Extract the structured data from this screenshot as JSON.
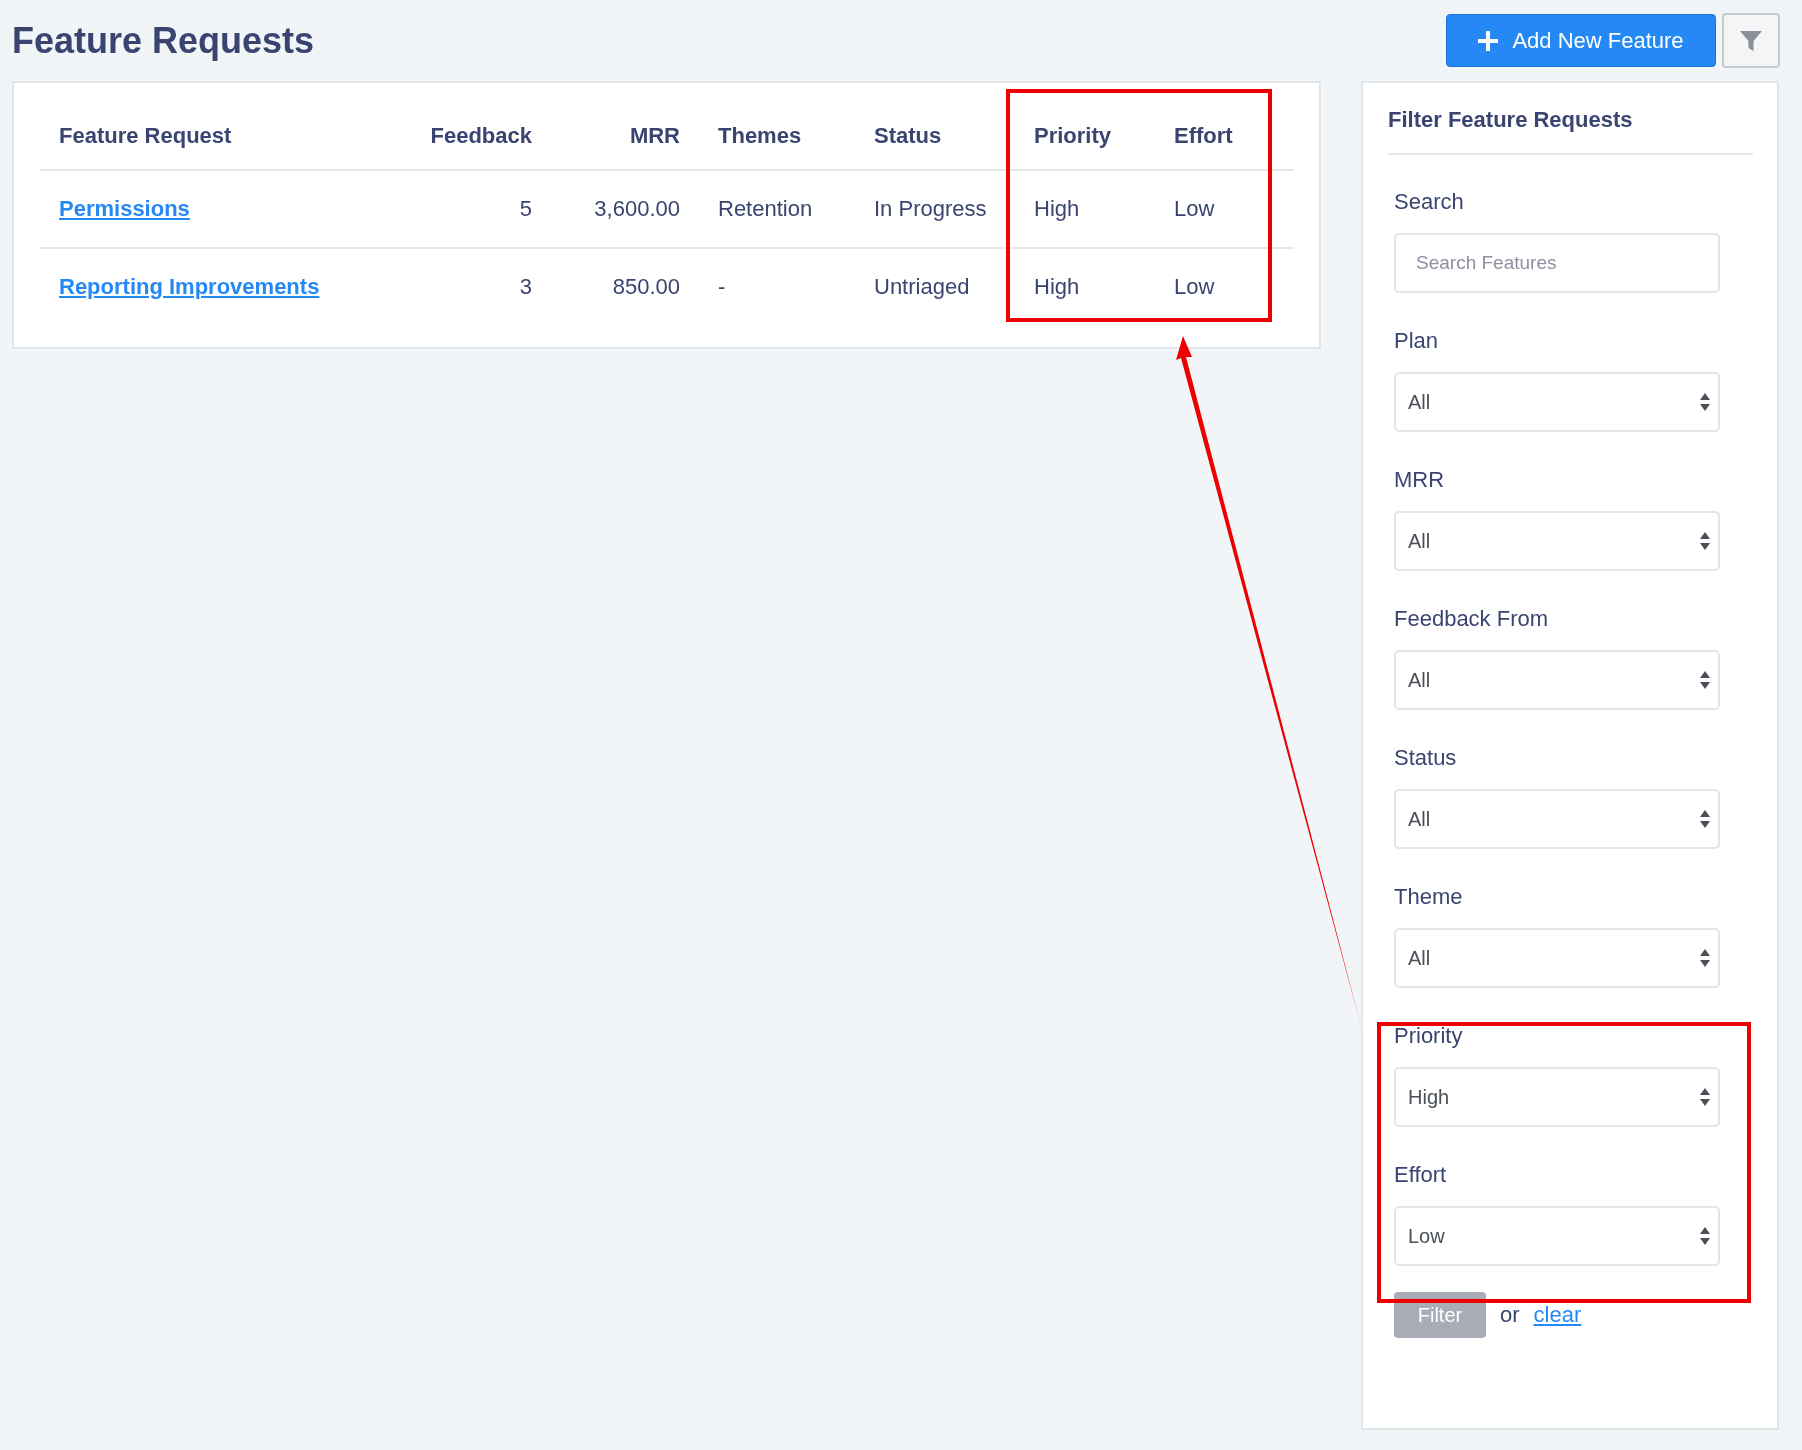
{
  "header": {
    "title": "Feature Requests",
    "add_button": "Add New Feature"
  },
  "table": {
    "columns": [
      "Feature Request",
      "Feedback",
      "MRR",
      "Themes",
      "Status",
      "Priority",
      "Effort"
    ],
    "rows": [
      {
        "cells": [
          "Permissions",
          "5",
          "3,600.00",
          "Retention",
          "In Progress",
          "High",
          "Low"
        ]
      },
      {
        "cells": [
          "Reporting Improvements",
          "3",
          "850.00",
          "-",
          "Untriaged",
          "High",
          "Low"
        ]
      }
    ]
  },
  "filter_panel": {
    "title": "Filter Feature Requests",
    "search": {
      "label": "Search",
      "placeholder": "Search Features"
    },
    "selects": [
      {
        "label": "Plan",
        "value": "All"
      },
      {
        "label": "MRR",
        "value": "All"
      },
      {
        "label": "Feedback From",
        "value": "All"
      },
      {
        "label": "Status",
        "value": "All"
      },
      {
        "label": "Theme",
        "value": "All"
      },
      {
        "label": "Priority",
        "value": "High"
      },
      {
        "label": "Effort",
        "value": "Low"
      }
    ],
    "filter_button": {
      "label": "Filter",
      "disabled": true
    },
    "or_text": "or",
    "clear_link": "clear"
  }
}
